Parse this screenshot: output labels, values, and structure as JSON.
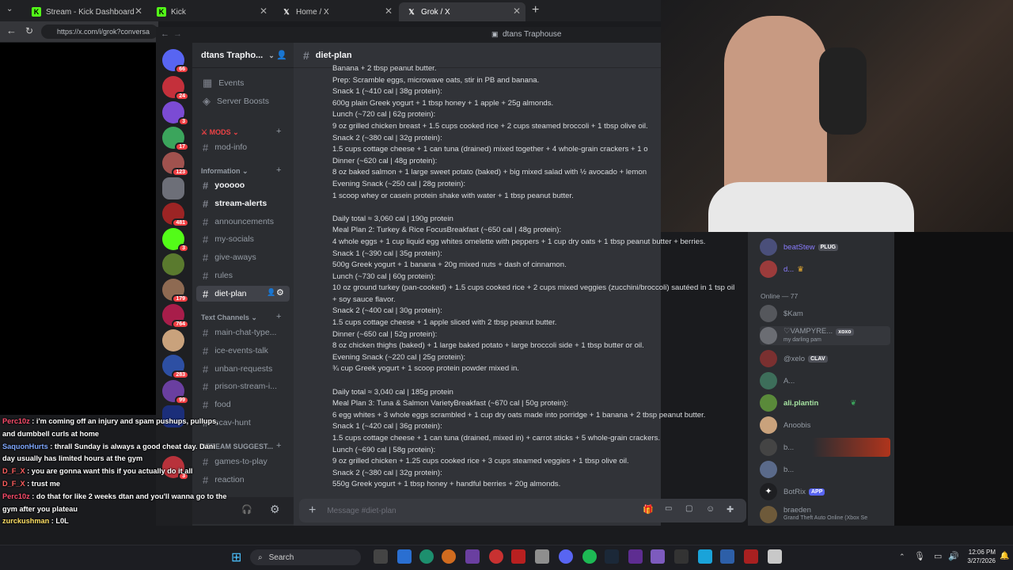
{
  "browser": {
    "tabs": [
      {
        "label": "Stream - Kick Dashboard",
        "active": false
      },
      {
        "label": "Kick",
        "active": false
      },
      {
        "label": "Home / X",
        "active": false
      },
      {
        "label": "Grok / X",
        "active": true
      }
    ],
    "url": "https://x.com/i/grok?conversa"
  },
  "discord": {
    "window_title": "dtans Traphouse",
    "server_name": "dtans Trapho...",
    "channels": [
      {
        "label": "Events",
        "kind": "calendar"
      },
      {
        "label": "Server Boosts",
        "kind": "boost"
      },
      {
        "label": "MODS",
        "kind": "category"
      },
      {
        "label": "mod-info",
        "kind": "text"
      },
      {
        "label": "Information",
        "kind": "category"
      },
      {
        "label": "yooooo",
        "kind": "text",
        "bold": true
      },
      {
        "label": "stream-alerts",
        "kind": "text",
        "bold": true
      },
      {
        "label": "announcements",
        "kind": "text"
      },
      {
        "label": "my-socials",
        "kind": "text"
      },
      {
        "label": "give-aways",
        "kind": "text"
      },
      {
        "label": "rules",
        "kind": "text"
      },
      {
        "label": "diet-plan",
        "kind": "text",
        "selected": true
      },
      {
        "label": "Text Channels",
        "kind": "category"
      },
      {
        "label": "main-chat-type...",
        "kind": "text"
      },
      {
        "label": "ice-events-talk",
        "kind": "text"
      },
      {
        "label": "unban-requests",
        "kind": "text"
      },
      {
        "label": "prison-stream-i...",
        "kind": "text"
      },
      {
        "label": "food",
        "kind": "text"
      },
      {
        "label": "scav-hunt",
        "kind": "text"
      },
      {
        "label": "STREAM SUGGEST...",
        "kind": "category"
      },
      {
        "label": "games-to-play",
        "kind": "text"
      },
      {
        "label": "reaction",
        "kind": "text"
      }
    ],
    "server_badges": [
      "66",
      "24",
      "3",
      "17",
      "123",
      "481",
      "3",
      "179",
      "764",
      "283",
      "99",
      "3"
    ],
    "channel_header": "diet-plan",
    "messages": [
      "Banana + 2 tbsp peanut butter.",
      "Prep: Scramble eggs, microwave oats, stir in PB and banana.",
      "Snack 1 (~410 cal | 38g protein):",
      "600g plain Greek yogurt + 1 tbsp honey + 1 apple + 25g almonds.",
      "Lunch (~720 cal | 62g protein):",
      "9 oz grilled chicken breast + 1.5 cups cooked rice + 2 cups steamed broccoli + 1 tbsp olive oil.",
      "Snack 2 (~380 cal | 32g protein):",
      "1.5 cups cottage cheese + 1 can tuna (drained) mixed together + 4 whole-grain crackers + 1 o",
      "Dinner (~620 cal | 48g protein):",
      "8 oz baked salmon + 1 large sweet potato (baked) + big mixed salad with ½ avocado + lemon",
      "Evening Snack (~250 cal | 28g protein):",
      "1 scoop whey or casein protein shake with water + 1 tbsp peanut butter.",
      "",
      "Daily total ≈ 3,060 cal | 190g protein",
      "Meal Plan 2: Turkey & Rice FocusBreakfast (~650 cal | 48g protein):",
      "4 whole eggs + 1 cup liquid egg whites omelette with peppers + 1 cup dry oats + 1 tbsp peanut butter + berries.",
      "Snack 1 (~390 cal | 35g protein):",
      "500g Greek yogurt + 1 banana + 20g mixed nuts + dash of cinnamon.",
      "Lunch (~730 cal | 60g protein):",
      "10 oz ground turkey (pan-cooked) + 1.5 cups cooked rice + 2 cups mixed veggies (zucchini/broccoli) sautéed in 1 tsp oil + soy sauce flavor.",
      "Snack 2 (~400 cal | 30g protein):",
      "1.5 cups cottage cheese + 1 apple sliced with 2 tbsp peanut butter.",
      "Dinner (~650 cal | 52g protein):",
      "8 oz chicken thighs (baked) + 1 large baked potato + large broccoli side + 1 tbsp butter or oil.",
      "Evening Snack (~220 cal | 25g protein):",
      "¾ cup Greek yogurt + 1 scoop protein powder mixed in.",
      "",
      "Daily total ≈ 3,040 cal | 185g protein",
      "Meal Plan 3: Tuna & Salmon VarietyBreakfast (~670 cal | 50g protein):",
      "6 egg whites + 3 whole eggs scrambled + 1 cup dry oats made into porridge + 1 banana + 2 tbsp peanut butter.",
      "Snack 1 (~420 cal | 36g protein):",
      "1.5 cups cottage cheese + 1 can tuna (drained, mixed in) + carrot sticks + 5 whole-grain crackers.",
      "Lunch (~690 cal | 58g protein):",
      "9 oz grilled chicken + 1.25 cups cooked rice + 3 cups steamed veggies + 1 tbsp olive oil.",
      "Snack 2 (~380 cal | 32g protein):",
      "550g Greek yogurt + 1 tbsp honey + handful berries + 20g almonds."
    ],
    "compose_placeholder": "Message #diet-plan",
    "members": [
      {
        "name": "beatStew",
        "tag": "PLUG",
        "color": "#8a7cff"
      },
      {
        "name": "d...",
        "tag": "",
        "color": "#8a7cff"
      },
      {
        "name": "Online — 77",
        "header": true
      },
      {
        "name": "$Kam",
        "tag": "",
        "color": "#b5bac1"
      },
      {
        "name": "♡VAMPYRE...",
        "tag": "xoxo",
        "sub": "my darling pam",
        "color": "#b5bac1"
      },
      {
        "name": "@xelo",
        "tag": "CLAV",
        "color": "#b5bac1"
      },
      {
        "name": "A...",
        "tag": "",
        "color": "#b5bac1"
      },
      {
        "name": "ali.plantin",
        "tag": "",
        "color": "#a6e3a1"
      },
      {
        "name": "Anoobis",
        "tag": "",
        "color": "#b5bac1"
      },
      {
        "name": "b...",
        "tag": "",
        "color": "#b5bac1"
      },
      {
        "name": "b...",
        "tag": "",
        "color": "#b5bac1"
      },
      {
        "name": "BotRix",
        "tag": "APP",
        "color": "#b5bac1"
      },
      {
        "name": "braeden",
        "tag": "",
        "sub": "Grand Theft Auto Online (Xbox Se",
        "color": "#b5bac1"
      }
    ]
  },
  "chat_overlay": [
    {
      "user": "Perc10z",
      "color": "#ff4d6d",
      "text": "i'm coming off an injury and spam pushups, pullups, and dumbbell curls at home"
    },
    {
      "user": "SaquonHurts",
      "color": "#7fa8ff",
      "text": "thrall Sunday is always a good cheat day. Dani day usually has limited hours at the gym"
    },
    {
      "user": "D_F_X",
      "color": "#ff5f5f",
      "text": "you are gonna want this if you actually do it all"
    },
    {
      "user": "D_F_X",
      "color": "#ff5f5f",
      "text": "trust me"
    },
    {
      "user": "Perc10z",
      "color": "#ff4d6d",
      "text": "do that for like 2 weeks dtan and you'll wanna go to the gym after you plateau"
    },
    {
      "user": "zurckushman",
      "color": "#ffe066",
      "text": "L0L"
    }
  ],
  "taskbar": {
    "search_label": "Search",
    "time": "12:06 PM",
    "date": "3/27/2026"
  },
  "colors": {
    "discord_bg": "#313338",
    "sidebar_bg": "#2b2d31",
    "server_rail": "#1e1f22",
    "accent": "#5865f2"
  }
}
